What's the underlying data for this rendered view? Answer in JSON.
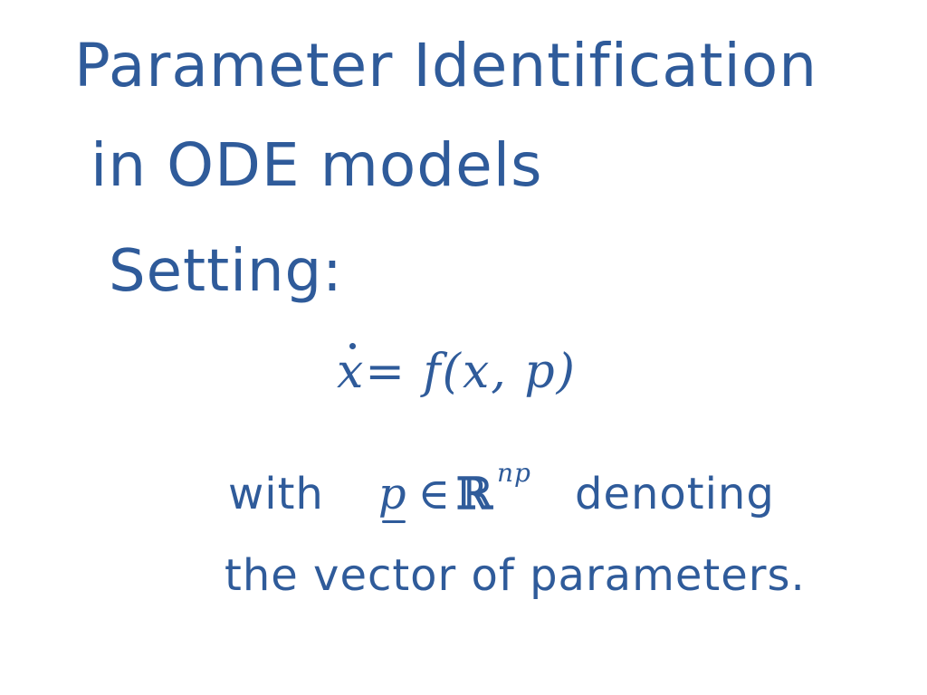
{
  "title": {
    "line1": "Parameter Identification",
    "line2": "in  ODE models"
  },
  "setting": {
    "heading": "Setting:"
  },
  "equation": {
    "lhs_var": "x",
    "rest": "= f(x, p)"
  },
  "description": {
    "line1_prefix": "with",
    "param_symbol": "p",
    "element_of": "∈",
    "set_symbol": "ℝ",
    "superscript": "np",
    "line1_suffix": "denoting",
    "line2": "the vector of parameters."
  },
  "colors": {
    "ink": "#2f5b9a",
    "background": "#ffffff"
  }
}
